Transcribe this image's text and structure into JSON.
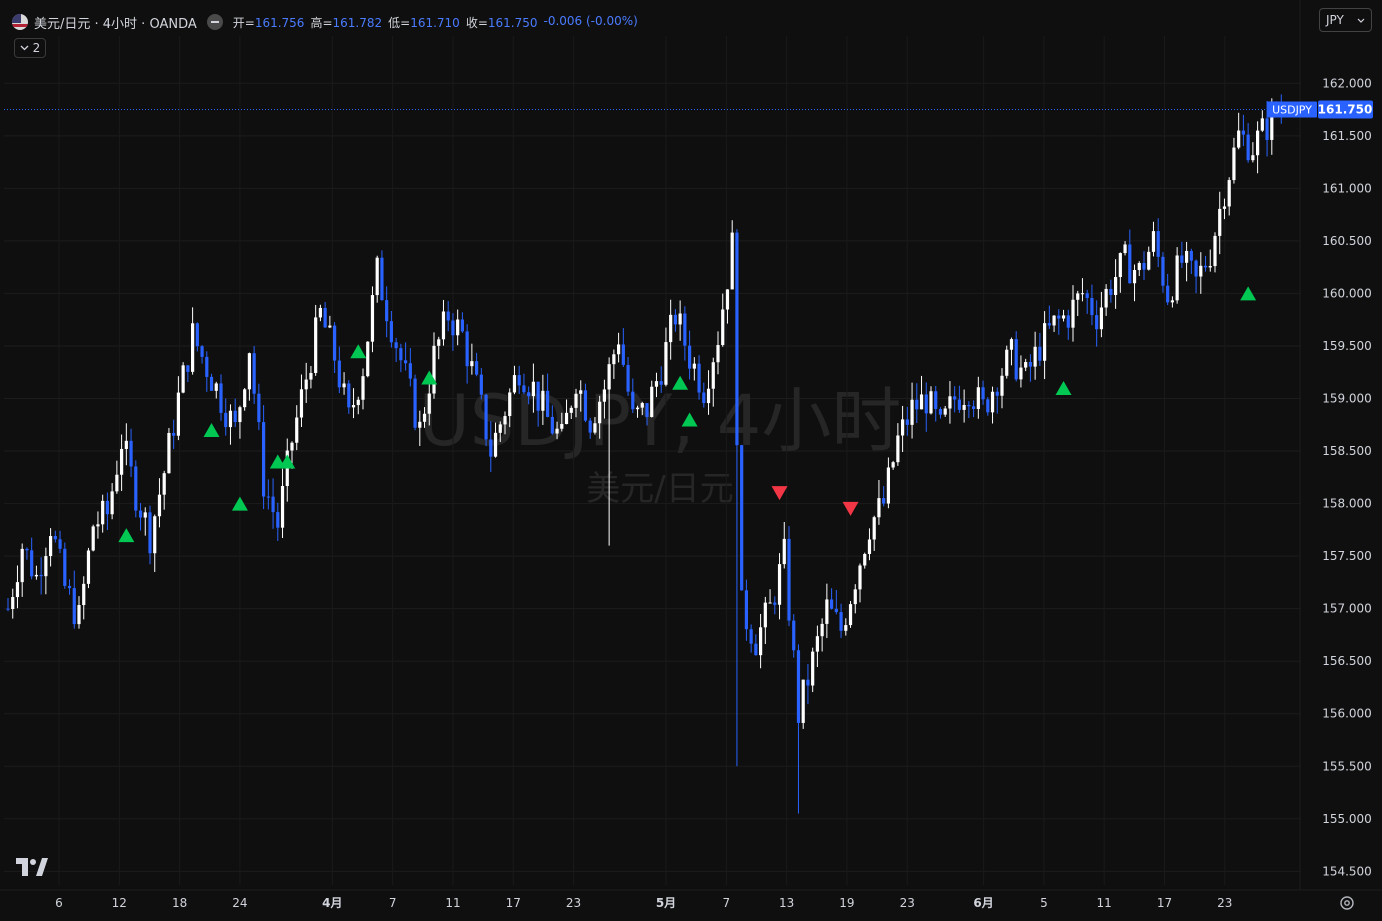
{
  "header": {
    "symbol_title": "美元/日元 · 4小时 · OANDA",
    "ohlc": [
      {
        "k": "开=",
        "v": "161.756"
      },
      {
        "k": "高=",
        "v": "161.782"
      },
      {
        "k": "低=",
        "v": "161.710"
      },
      {
        "k": "收=",
        "v": "161.750"
      }
    ],
    "change": "-0.006 (-0.00%)",
    "indicator_count": "2",
    "currency": "JPY"
  },
  "watermark": {
    "line1": "USDJPY, 4小时",
    "line2": "美元/日元"
  },
  "colors": {
    "up": "#ffffff",
    "down": "#2962ff",
    "buy": "#00c853",
    "sell": "#f23645",
    "price_label": "#2962ff"
  },
  "chart_data": {
    "type": "candlestick",
    "price_label": {
      "symbol": "USDJPY",
      "value": "161.750",
      "price": 161.75
    },
    "y_ticks": [
      "162.000",
      "161.500",
      "161.000",
      "160.500",
      "160.000",
      "159.500",
      "159.000",
      "158.500",
      "158.000",
      "157.500",
      "157.000",
      "156.500",
      "156.000",
      "155.500",
      "155.000",
      "154.500"
    ],
    "x_ticks": [
      "6",
      "12",
      "18",
      "24",
      "4月",
      "7",
      "11",
      "17",
      "23",
      "5月",
      "7",
      "13",
      "19",
      "23",
      "6月",
      "5",
      "11",
      "17",
      "23"
    ],
    "ylim": [
      154.37,
      162.45
    ],
    "close_path": [
      [
        0,
        157.0
      ],
      [
        3,
        157.6
      ],
      [
        6,
        157.3
      ],
      [
        9,
        157.8
      ],
      [
        12,
        157.2
      ],
      [
        15,
        156.9
      ],
      [
        18,
        157.8
      ],
      [
        21,
        157.9
      ],
      [
        24,
        158.6
      ],
      [
        27,
        158.1
      ],
      [
        30,
        157.7
      ],
      [
        33,
        158.3
      ],
      [
        36,
        159.0
      ],
      [
        39,
        159.6
      ],
      [
        42,
        159.3
      ],
      [
        45,
        159.0
      ],
      [
        48,
        158.7
      ],
      [
        51,
        159.5
      ],
      [
        54,
        158.2
      ],
      [
        57,
        157.8
      ],
      [
        60,
        158.6
      ],
      [
        63,
        159.2
      ],
      [
        66,
        159.8
      ],
      [
        69,
        159.4
      ],
      [
        72,
        158.8
      ],
      [
        75,
        159.3
      ],
      [
        78,
        160.2
      ],
      [
        81,
        159.7
      ],
      [
        84,
        159.2
      ],
      [
        87,
        158.7
      ],
      [
        90,
        159.4
      ],
      [
        93,
        159.8
      ],
      [
        96,
        159.6
      ],
      [
        99,
        159.1
      ],
      [
        102,
        158.5
      ],
      [
        105,
        158.9
      ],
      [
        108,
        159.3
      ],
      [
        111,
        159.1
      ],
      [
        114,
        158.8
      ],
      [
        117,
        158.6
      ],
      [
        120,
        159.2
      ],
      [
        123,
        158.8
      ],
      [
        126,
        159.1
      ],
      [
        129,
        159.6
      ],
      [
        132,
        158.8
      ],
      [
        135,
        158.9
      ],
      [
        138,
        159.3
      ],
      [
        141,
        159.8
      ],
      [
        144,
        159.4
      ],
      [
        147,
        159.1
      ],
      [
        150,
        159.6
      ],
      [
        153,
        160.45
      ],
      [
        155,
        157.0
      ],
      [
        158,
        156.7
      ],
      [
        161,
        157.0
      ],
      [
        164,
        157.5
      ],
      [
        167,
        156.0
      ],
      [
        170,
        156.5
      ],
      [
        173,
        157.0
      ],
      [
        176,
        156.8
      ],
      [
        179,
        157.3
      ],
      [
        182,
        157.8
      ],
      [
        185,
        158.0
      ],
      [
        188,
        158.6
      ],
      [
        191,
        158.9
      ],
      [
        194,
        159.0
      ],
      [
        197,
        158.7
      ],
      [
        200,
        159.0
      ],
      [
        203,
        159.1
      ],
      [
        206,
        158.9
      ],
      [
        209,
        159.2
      ],
      [
        212,
        159.4
      ],
      [
        215,
        159.2
      ],
      [
        218,
        159.5
      ],
      [
        221,
        159.7
      ],
      [
        224,
        159.8
      ],
      [
        227,
        160.0
      ],
      [
        230,
        159.8
      ],
      [
        233,
        160.1
      ],
      [
        236,
        160.3
      ],
      [
        239,
        160.2
      ],
      [
        242,
        160.5
      ],
      [
        245,
        160.0
      ],
      [
        248,
        160.3
      ],
      [
        251,
        160.1
      ],
      [
        254,
        160.4
      ],
      [
        257,
        161.0
      ],
      [
        260,
        161.5
      ],
      [
        263,
        161.4
      ],
      [
        266,
        161.6
      ],
      [
        268,
        161.75
      ]
    ],
    "markers": [
      {
        "type": "buy",
        "bar": 25,
        "price": 157.7
      },
      {
        "type": "buy",
        "bar": 43,
        "price": 158.7
      },
      {
        "type": "buy",
        "bar": 49,
        "price": 158.0
      },
      {
        "type": "buy",
        "bar": 57,
        "price": 158.4
      },
      {
        "type": "buy",
        "bar": 59,
        "price": 158.4
      },
      {
        "type": "buy",
        "bar": 74,
        "price": 159.45
      },
      {
        "type": "buy",
        "bar": 89,
        "price": 159.2
      },
      {
        "type": "buy",
        "bar": 142,
        "price": 159.15
      },
      {
        "type": "buy",
        "bar": 144,
        "price": 158.8
      },
      {
        "type": "sell",
        "bar": 163,
        "price": 158.1
      },
      {
        "type": "sell",
        "bar": 178,
        "price": 157.95
      },
      {
        "type": "buy",
        "bar": 223,
        "price": 159.1
      },
      {
        "type": "buy",
        "bar": 262,
        "price": 160.0
      }
    ]
  }
}
